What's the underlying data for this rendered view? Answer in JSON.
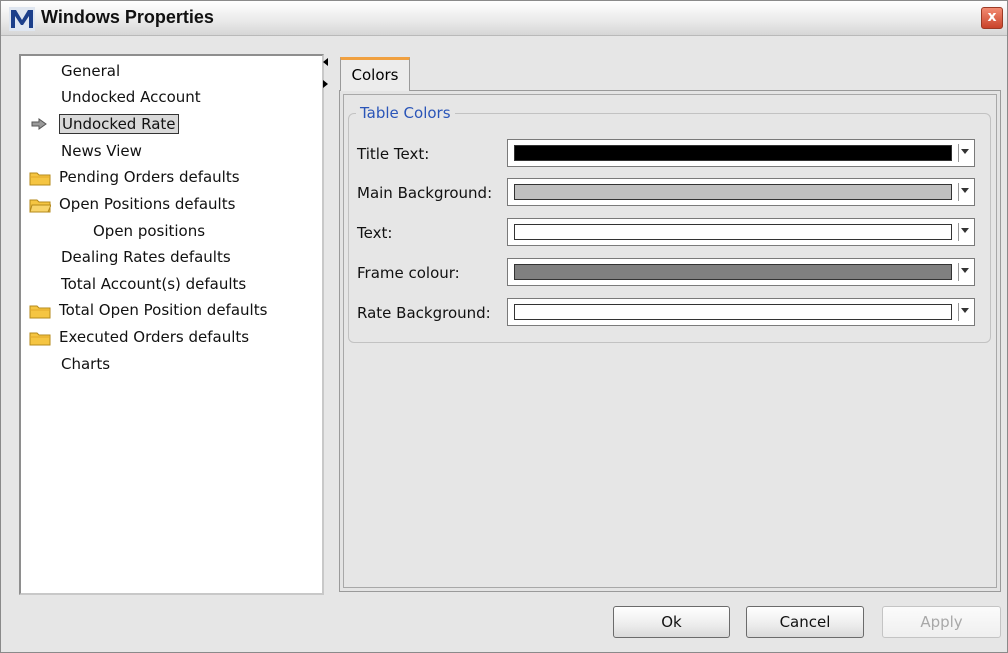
{
  "window": {
    "title": "Windows Properties",
    "close_label": "x"
  },
  "tree": {
    "items": [
      {
        "label": "General",
        "icon": "none"
      },
      {
        "label": "Undocked Account",
        "icon": "none"
      },
      {
        "label": "Undocked Rate",
        "icon": "none",
        "selected": true
      },
      {
        "label": "News View",
        "icon": "none"
      },
      {
        "label": "Pending Orders defaults",
        "icon": "folder-icon"
      },
      {
        "label": "Open Positions defaults",
        "icon": "folder-icon"
      },
      {
        "label": "Open positions",
        "icon": "none"
      },
      {
        "label": "Dealing Rates defaults",
        "icon": "none"
      },
      {
        "label": "Total Account(s) defaults",
        "icon": "none"
      },
      {
        "label": "Total Open Position defaults",
        "icon": "folder-icon"
      },
      {
        "label": "Executed Orders defaults",
        "icon": "folder-icon"
      },
      {
        "label": "Charts",
        "icon": "none"
      }
    ]
  },
  "tabs": [
    {
      "label": "Colors",
      "active": true
    }
  ],
  "table_colors": {
    "group_title": "Table Colors",
    "rows": [
      {
        "label": "Title Text:",
        "color": "#000000"
      },
      {
        "label": "Main Background:",
        "color": "#c0c0c0"
      },
      {
        "label": "Text:",
        "color": "#ffffff"
      },
      {
        "label": "Frame colour:",
        "color": "#808080"
      },
      {
        "label": "Rate Background:",
        "color": "#ffffff"
      }
    ]
  },
  "buttons": {
    "ok": "Ok",
    "cancel": "Cancel",
    "apply": "Apply"
  },
  "colors": {
    "tab_accent": "#f0a040",
    "group_title": "#2a55b8",
    "folder": "#f5c542"
  }
}
